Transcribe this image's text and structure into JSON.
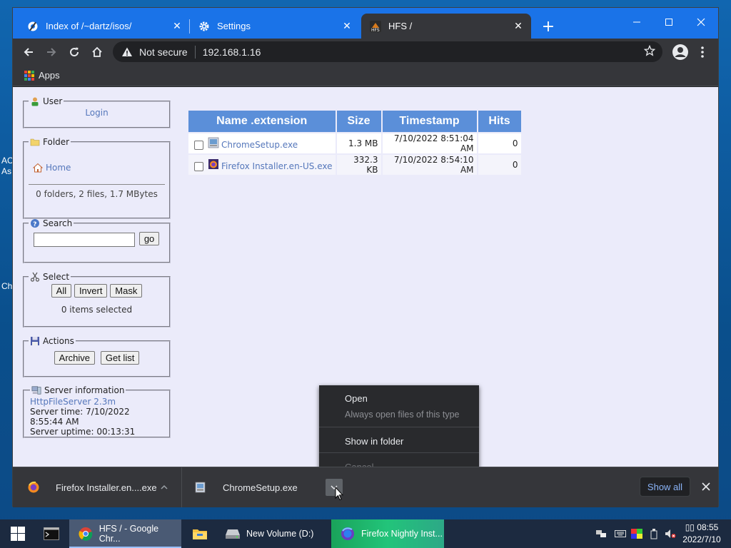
{
  "desktop": {
    "fragments": [
      "AC",
      "As",
      "Ch"
    ]
  },
  "browser": {
    "tabs": [
      {
        "title": "Index of /~dartz/isos/",
        "active": false
      },
      {
        "title": "Settings",
        "active": false
      },
      {
        "title": "HFS /",
        "active": true
      }
    ],
    "address": {
      "security_label": "Not secure",
      "url": "192.168.1.16"
    },
    "bookmarks_bar": {
      "apps_label": "Apps"
    }
  },
  "page": {
    "user_box": {
      "legend": "User",
      "login": "Login"
    },
    "folder_box": {
      "legend": "Folder",
      "home": "Home",
      "summary": "0 folders, 2 files, 1.7 MBytes"
    },
    "search_box": {
      "legend": "Search",
      "go": "go",
      "value": ""
    },
    "select_box": {
      "legend": "Select",
      "all": "All",
      "invert": "Invert",
      "mask": "Mask",
      "status": "0 items selected"
    },
    "actions_box": {
      "legend": "Actions",
      "archive": "Archive",
      "get_list": "Get list"
    },
    "server_box": {
      "legend": "Server information",
      "version": "HttpFileServer 2.3m",
      "time": "Server time: 7/10/2022 8:55:44 AM",
      "uptime": "Server uptime: 00:13:31"
    },
    "file_table": {
      "headers": [
        "Name .extension",
        "Size",
        "Timestamp",
        "Hits"
      ],
      "rows": [
        {
          "name": "ChromeSetup.exe",
          "size": "1.3 MB",
          "timestamp": "7/10/2022 8:51:04 AM",
          "hits": "0"
        },
        {
          "name": "Firefox Installer.en-US.exe",
          "size": "332.3 KB",
          "timestamp": "7/10/2022 8:54:10 AM",
          "hits": "0"
        }
      ]
    }
  },
  "context_menu": {
    "open": "Open",
    "always_open": "Always open files of this type",
    "show_in_folder": "Show in folder",
    "cancel": "Cancel"
  },
  "download_shelf": {
    "items": [
      {
        "name": "Firefox Installer.en....exe"
      },
      {
        "name": "ChromeSetup.exe"
      }
    ],
    "show_all": "Show all"
  },
  "taskbar": {
    "apps": [
      {
        "label": "HFS / - Google Chr..."
      },
      {
        "label": "New Volume (D:)"
      },
      {
        "label": "Firefox Nightly Inst..."
      }
    ],
    "clock_time": "08:55",
    "clock_prefix": "▯▯",
    "clock_date": "2022/7/10"
  },
  "colors": {
    "tabstrip": "#1a73e8",
    "toolbar": "#35363a",
    "page_bg": "#ebebfa",
    "table_header": "#5b8fd9",
    "link": "#5577bb"
  }
}
